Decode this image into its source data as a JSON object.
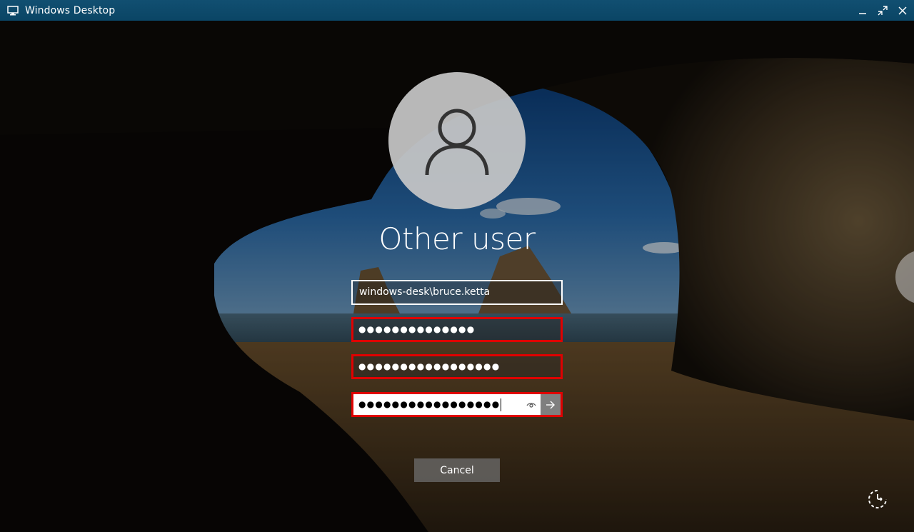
{
  "window": {
    "title": "Windows Desktop",
    "icon": "monitor-icon",
    "controls": [
      "minimize-icon",
      "restore-icon",
      "close-icon"
    ]
  },
  "login": {
    "avatar_icon": "user-icon",
    "user_heading": "Other user",
    "username_value": "windows-desk\\bruce.ketta",
    "password_fields": [
      {
        "mask": "●●●●●●●●●●●●●●",
        "highlighted": true
      },
      {
        "mask": "●●●●●●●●●●●●●●●●●",
        "highlighted": true
      },
      {
        "mask": "●●●●●●●●●●●●●●●●●",
        "highlighted": true,
        "focused": true
      }
    ],
    "reveal_icon": "eye-icon",
    "submit_icon": "arrow-right-icon",
    "cancel_label": "Cancel",
    "ease_of_access_icon": "ease-of-access-icon"
  },
  "colors": {
    "titlebar": "#0a4565",
    "highlight_border": "#e00000",
    "avatar_bg": "#c8c8c8"
  }
}
